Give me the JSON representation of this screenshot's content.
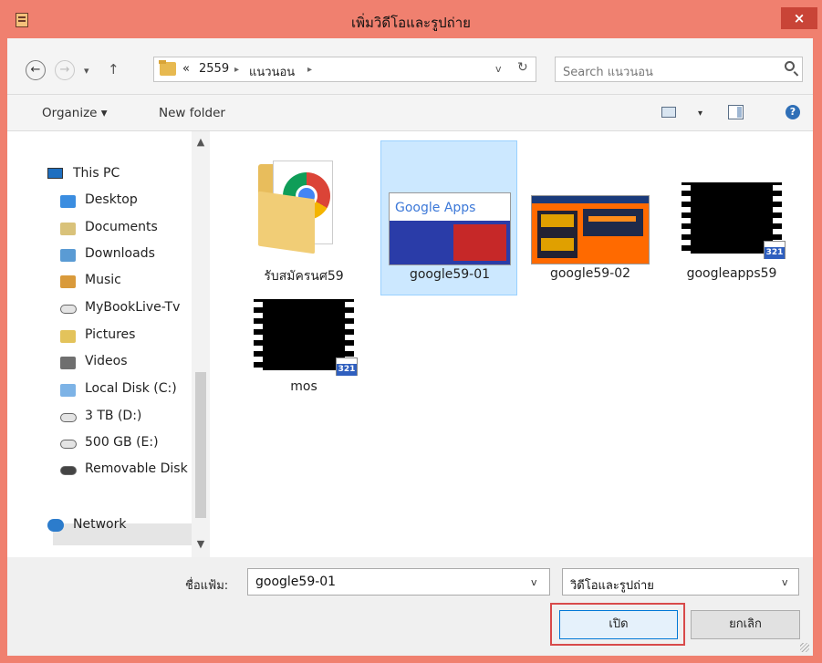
{
  "window": {
    "title": "เพิ่มวิดีโอและรูปถ่าย",
    "close": "×"
  },
  "nav": {
    "back": "←",
    "forward": "→",
    "dropdown": "▾",
    "up": "↑",
    "refresh": "↻"
  },
  "address": {
    "overflow": "«",
    "crumbs": [
      "2559",
      "แนวนอน"
    ],
    "separator": "▸",
    "dropdown": "v"
  },
  "search": {
    "placeholder": "Search แนวนอน"
  },
  "toolbar": {
    "organize": "Organize ▾",
    "new_folder": "New folder",
    "help": "?",
    "view_dropdown": "▾"
  },
  "sidebar": {
    "scroll_up": "▲",
    "scroll_down": "▼",
    "items": [
      {
        "label": "This PC",
        "icon": "computer-icon"
      },
      {
        "label": "Desktop",
        "icon": "desktop-folder-icon"
      },
      {
        "label": "Documents",
        "icon": "documents-folder-icon"
      },
      {
        "label": "Downloads",
        "icon": "downloads-folder-icon"
      },
      {
        "label": "Music",
        "icon": "music-folder-icon"
      },
      {
        "label": "MyBookLive-Tv",
        "icon": "network-drive-icon"
      },
      {
        "label": "Pictures",
        "icon": "pictures-folder-icon"
      },
      {
        "label": "Videos",
        "icon": "videos-folder-icon"
      },
      {
        "label": "Local Disk (C:)",
        "icon": "system-drive-icon"
      },
      {
        "label": "3 TB (D:)",
        "icon": "drive-icon"
      },
      {
        "label": "500 GB (E:)",
        "icon": "drive-icon",
        "selected": true
      },
      {
        "label": "Removable Disk",
        "icon": "removable-drive-icon"
      },
      {
        "label": "Network",
        "icon": "network-icon"
      }
    ]
  },
  "files": [
    {
      "name": "รับสมัครนศ59",
      "type": "folder"
    },
    {
      "name": "google59-01",
      "type": "image",
      "selected": true,
      "preview_text": "Google Apps"
    },
    {
      "name": "google59-02",
      "type": "image"
    },
    {
      "name": "googleapps59",
      "type": "video",
      "badge": "321"
    },
    {
      "name": "mos",
      "type": "video",
      "badge": "321"
    }
  ],
  "footer": {
    "filename_label": "ชื่อแฟ้ม:",
    "filename_value": "google59-01",
    "filetype_value": "วิดีโอและรูปถ่าย",
    "dropdown": "v",
    "open_button": "เปิด",
    "cancel_button": "ยกเลิก"
  },
  "colors": {
    "titlebar": "#f0806f",
    "selection": "#cce8ff",
    "highlight_box": "#d84a4a",
    "close_button": "#c94437"
  }
}
